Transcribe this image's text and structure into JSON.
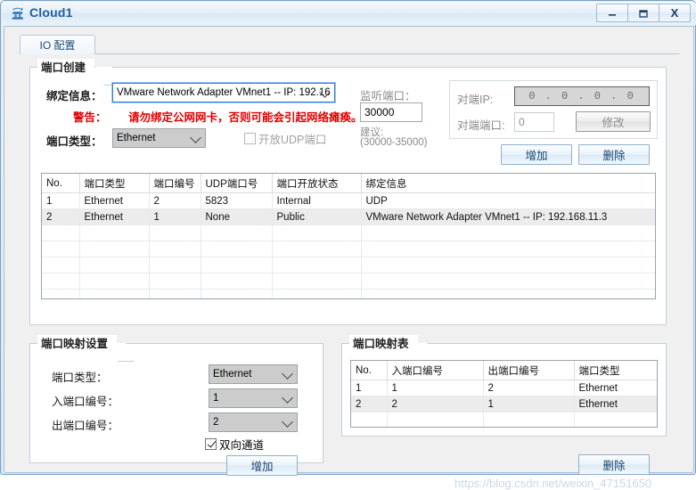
{
  "window": {
    "title": "Cloud1",
    "icon": "cloud-network-icon",
    "minimize_label": "—",
    "maximize_label": "❐",
    "close_label": "X"
  },
  "tabs": [
    {
      "label": "IO 配置",
      "selected": true
    }
  ],
  "port_create": {
    "caption": "端口创建",
    "binding_label": "绑定信息：",
    "binding_value": "VMware Network Adapter VMnet1 -- IP: 192.16",
    "warning_label": "警告：",
    "warning_text": "请勿绑定公网网卡，否则可能会引起网络瘫痪。",
    "port_type_label": "端口类型：",
    "port_type_value": "Ethernet",
    "udp_checkbox_label": "开放UDP端口",
    "udp_checked": false,
    "listen_port_label": "监听端口：",
    "listen_port_value": "30000",
    "suggest_label": "建议:",
    "suggest_range": "(30000-35000)",
    "peer_ip_label": "对端IP:",
    "peer_ip_value": "0 . 0 . 0 . 0",
    "peer_port_label": "对端端口:",
    "peer_port_value": "0",
    "modify_button": "修改",
    "add_button": "增加",
    "delete_button": "删除"
  },
  "port_table": {
    "headers": [
      "No.",
      "端口类型",
      "端口编号",
      "UDP端口号",
      "端口开放状态",
      "绑定信息"
    ],
    "rows": [
      [
        "1",
        "Ethernet",
        "2",
        "5823",
        "Internal",
        "UDP"
      ],
      [
        "2",
        "Ethernet",
        "1",
        "None",
        "Public",
        "VMware Network Adapter VMnet1 -- IP: 192.168.11.3"
      ]
    ],
    "empty_row_count": 6,
    "selected_row_index": 1
  },
  "mapping_settings": {
    "caption": "端口映射设置",
    "port_type_label": "端口类型：",
    "port_type_value": "Ethernet",
    "in_port_label": "入端口编号：",
    "in_port_value": "1",
    "out_port_label": "出端口编号：",
    "out_port_value": "2",
    "bidirectional_label": "双向通道",
    "bidirectional_checked": true,
    "add_button": "增加"
  },
  "mapping_table": {
    "caption": "端口映射表",
    "headers": [
      "No.",
      "入端口编号",
      "出端口编号",
      "端口类型"
    ],
    "rows": [
      [
        "1",
        "1",
        "2",
        "Ethernet"
      ],
      [
        "2",
        "2",
        "1",
        "Ethernet"
      ]
    ],
    "empty_row_count": 3,
    "selected_row_index": 1,
    "delete_button": "删除"
  },
  "watermark": "https://blog.csdn.net/weixin_47151650",
  "colors": {
    "title_text": "#1b5f9e",
    "warning": "#e00000",
    "accent_button_text": "#17436e",
    "selected_row": "#ececec"
  }
}
